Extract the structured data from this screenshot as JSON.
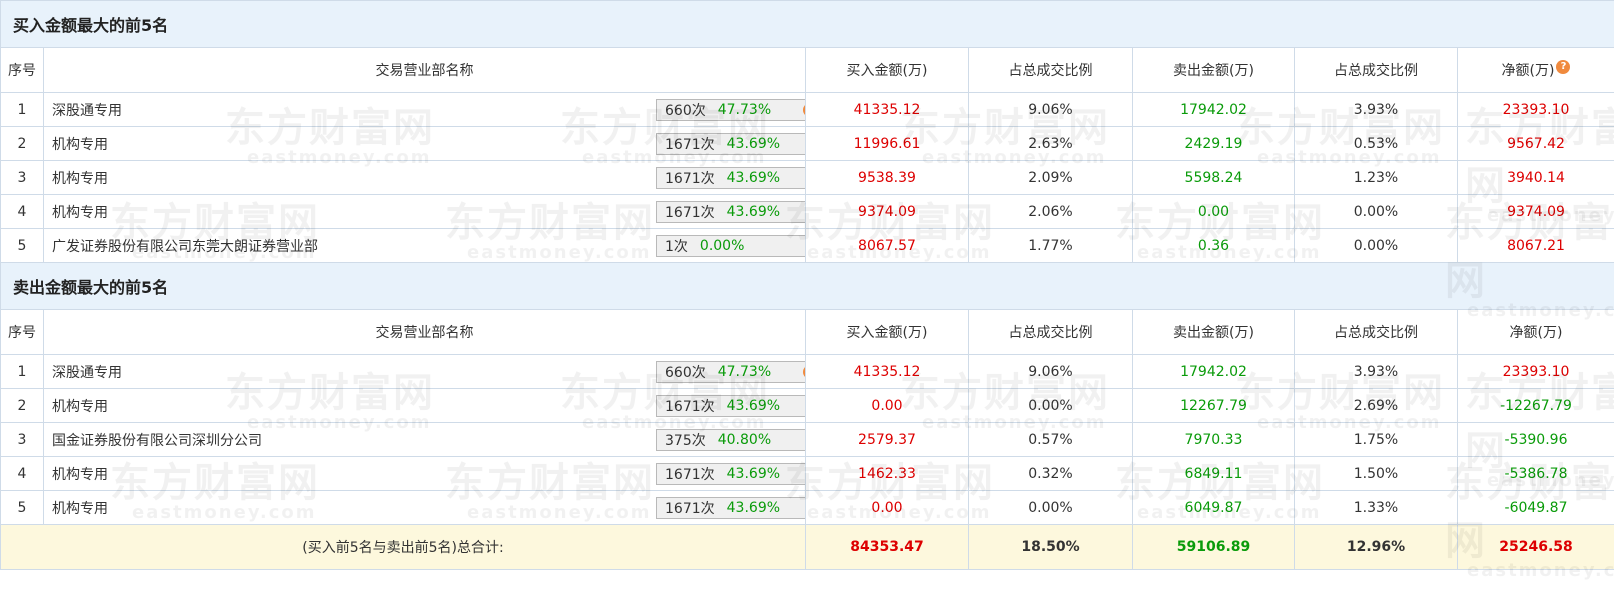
{
  "buy_section": {
    "title": "买入金额最大的前5名",
    "headers": [
      "序号",
      "交易营业部名称",
      "买入金额(万)",
      "占总成交比例",
      "卖出金额(万)",
      "占总成交比例",
      "净额(万)"
    ],
    "rows": [
      {
        "idx": "1",
        "name": "深股通专用",
        "count": "660次",
        "pct": "47.73%",
        "icon": "question-icon",
        "buy": "41335.12",
        "buy_pct": "9.06%",
        "sell": "17942.02",
        "sell_pct": "3.93%",
        "net": "23393.10"
      },
      {
        "idx": "2",
        "name": "机构专用",
        "count": "1671次",
        "pct": "43.69%",
        "icon": "play-arrow-icon",
        "buy": "11996.61",
        "buy_pct": "2.63%",
        "sell": "2429.19",
        "sell_pct": "0.53%",
        "net": "9567.42"
      },
      {
        "idx": "3",
        "name": "机构专用",
        "count": "1671次",
        "pct": "43.69%",
        "icon": "play-arrow-icon",
        "buy": "9538.39",
        "buy_pct": "2.09%",
        "sell": "5598.24",
        "sell_pct": "1.23%",
        "net": "3940.14"
      },
      {
        "idx": "4",
        "name": "机构专用",
        "count": "1671次",
        "pct": "43.69%",
        "icon": "play-arrow-icon",
        "buy": "9374.09",
        "buy_pct": "2.06%",
        "sell": "0.00",
        "sell_pct": "0.00%",
        "net": "9374.09"
      },
      {
        "idx": "5",
        "name": "广发证券股份有限公司东莞大朗证券营业部",
        "count": "1次",
        "pct": "0.00%",
        "icon": "play-arrow-icon",
        "buy": "8067.57",
        "buy_pct": "1.77%",
        "sell": "0.36",
        "sell_pct": "0.00%",
        "net": "8067.21"
      }
    ]
  },
  "sell_section": {
    "title": "卖出金额最大的前5名",
    "headers": [
      "序号",
      "交易营业部名称",
      "买入金额(万)",
      "占总成交比例",
      "卖出金额(万)",
      "占总成交比例",
      "净额(万)"
    ],
    "rows": [
      {
        "idx": "1",
        "name": "深股通专用",
        "count": "660次",
        "pct": "47.73%",
        "icon": "question-icon",
        "buy": "41335.12",
        "buy_pct": "9.06%",
        "sell": "17942.02",
        "sell_pct": "3.93%",
        "net": "23393.10"
      },
      {
        "idx": "2",
        "name": "机构专用",
        "count": "1671次",
        "pct": "43.69%",
        "icon": "play-arrow-icon",
        "buy": "0.00",
        "buy_pct": "0.00%",
        "sell": "12267.79",
        "sell_pct": "2.69%",
        "net": "-12267.79"
      },
      {
        "idx": "3",
        "name": "国金证券股份有限公司深圳分公司",
        "count": "375次",
        "pct": "40.80%",
        "icon": "play-arrow-icon",
        "buy": "2579.37",
        "buy_pct": "0.57%",
        "sell": "7970.33",
        "sell_pct": "1.75%",
        "net": "-5390.96"
      },
      {
        "idx": "4",
        "name": "机构专用",
        "count": "1671次",
        "pct": "43.69%",
        "icon": "play-arrow-icon",
        "buy": "1462.33",
        "buy_pct": "0.32%",
        "sell": "6849.11",
        "sell_pct": "1.50%",
        "net": "-5386.78"
      },
      {
        "idx": "5",
        "name": "机构专用",
        "count": "1671次",
        "pct": "43.69%",
        "icon": "play-arrow-icon",
        "buy": "0.00",
        "buy_pct": "0.00%",
        "sell": "6049.87",
        "sell_pct": "1.33%",
        "net": "-6049.87"
      }
    ]
  },
  "total": {
    "label": "(买入前5名与卖出前5名)总合计:",
    "buy": "84353.47",
    "buy_pct": "18.50%",
    "sell": "59106.89",
    "sell_pct": "12.96%",
    "net": "25246.58"
  },
  "watermark": {
    "cn": "东方财富网",
    "en": "eastmoney.com"
  },
  "colors": {
    "red": "#dd0000",
    "green": "#0a9b0a",
    "header_bg": "#e8f2fb",
    "total_bg": "#fdf8dd",
    "border": "#cfdbe8"
  }
}
